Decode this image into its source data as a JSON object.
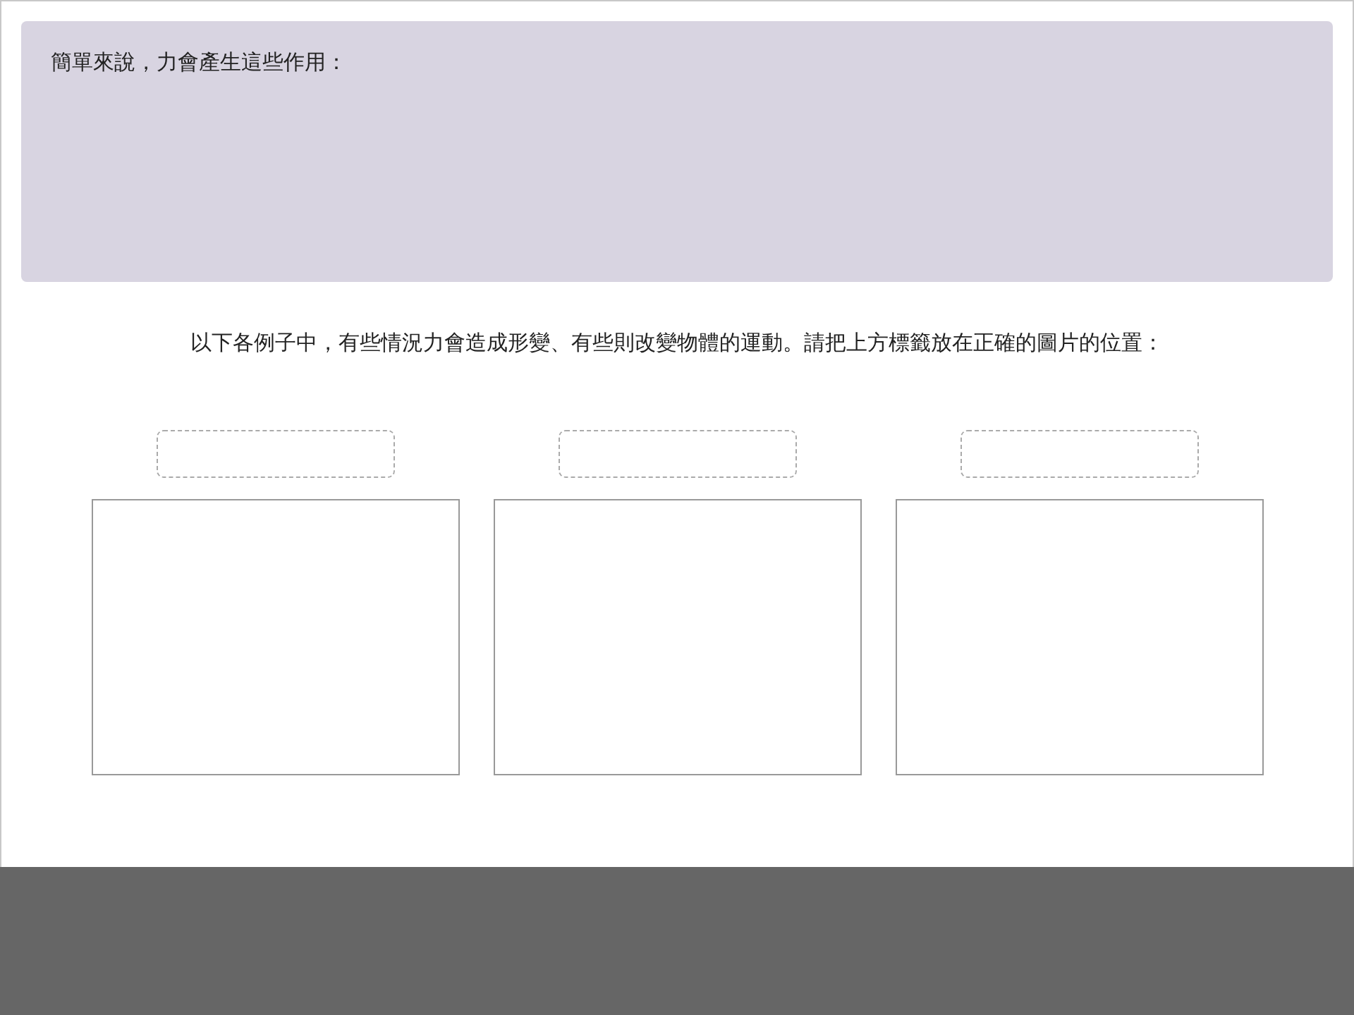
{
  "summary_panel": {
    "heading": "簡單來說，力會產生這些作用："
  },
  "instruction": "以下各例子中，有些情況力會造成形變、有些則改變物體的運動。請把上方標籤放在正確的圖片的位置："
}
